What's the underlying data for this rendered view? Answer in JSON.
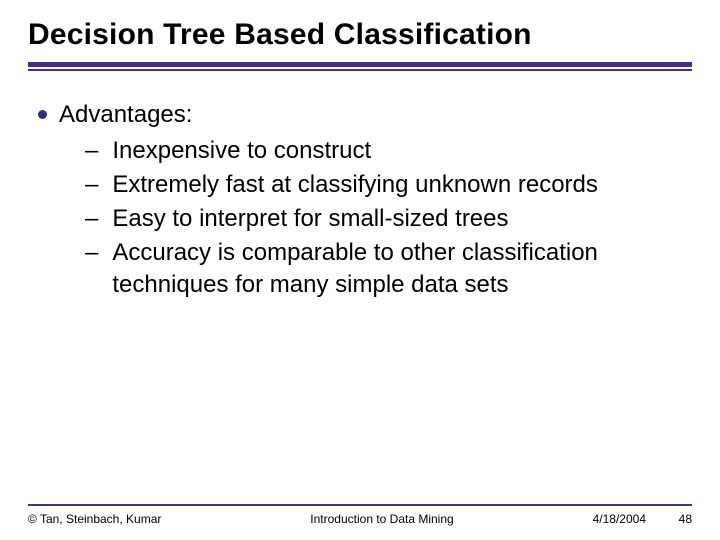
{
  "title": "Decision Tree Based Classification",
  "bullet": {
    "heading": "Advantages:",
    "items": [
      "Inexpensive to construct",
      "Extremely fast at classifying unknown records",
      "Easy to interpret for small-sized trees",
      "Accuracy is comparable to other classification techniques for many simple data sets"
    ]
  },
  "footer": {
    "authors": "© Tan, Steinbach, Kumar",
    "course": "Introduction to Data Mining",
    "date": "4/18/2004",
    "page": "48"
  },
  "colors": {
    "accent": "#4a2c8f",
    "dot": "#2f2e8c"
  }
}
